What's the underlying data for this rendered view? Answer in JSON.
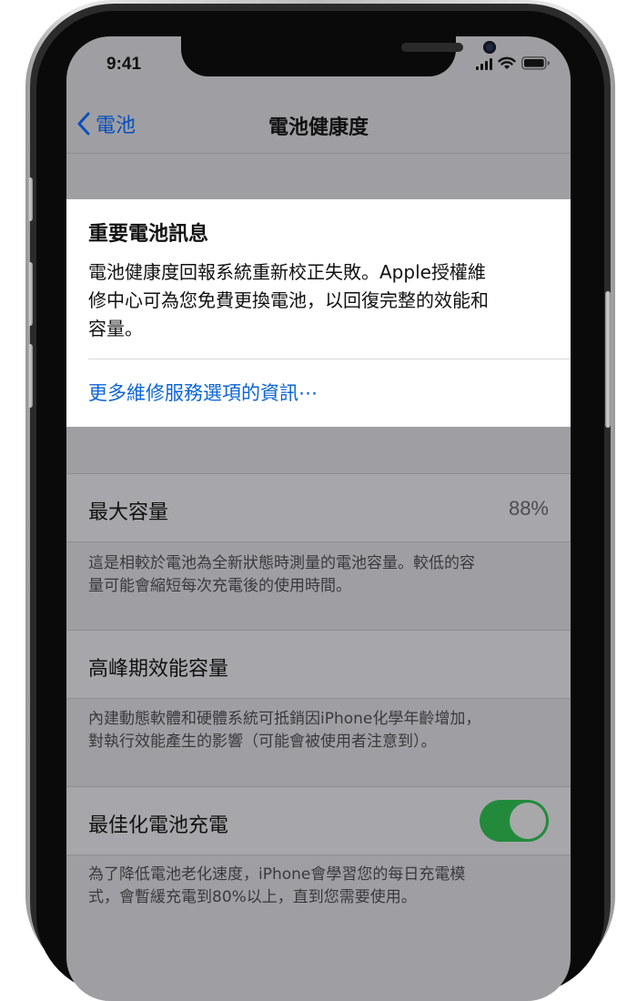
{
  "status": {
    "time": "9:41"
  },
  "nav": {
    "back_label": "電池",
    "title": "電池健康度"
  },
  "notice": {
    "title": "重要電池訊息",
    "body_lines": [
      "電池健康度回報系統重新校正失敗。Apple授權維",
      "修中心可為您免費更換電池，以回復完整的效能和",
      "容量。"
    ],
    "link": "更多維修服務選項的資訊⋯"
  },
  "max_capacity": {
    "label": "最大容量",
    "value": "88%",
    "footnote_lines": [
      "這是相較於電池為全新狀態時測量的電池容量。較低的容",
      "量可能會縮短每次充電後的使用時間。"
    ]
  },
  "peak_performance": {
    "label": "高峰期效能容量",
    "footnote_lines": [
      "內建動態軟體和硬體系統可抵銷因iPhone化學年齡增加，",
      "對執行效能產生的影響（可能會被使用者注意到）。"
    ]
  },
  "optimized_charging": {
    "label": "最佳化電池充電",
    "enabled": true,
    "footnote_lines": [
      "為了降低電池老化速度，iPhone會學習您的每日充電模",
      "式，會暫緩充電到80%以上，直到您需要使用。"
    ]
  },
  "colors": {
    "link": "#0a64d6",
    "toggle_on": "#238a3c"
  }
}
